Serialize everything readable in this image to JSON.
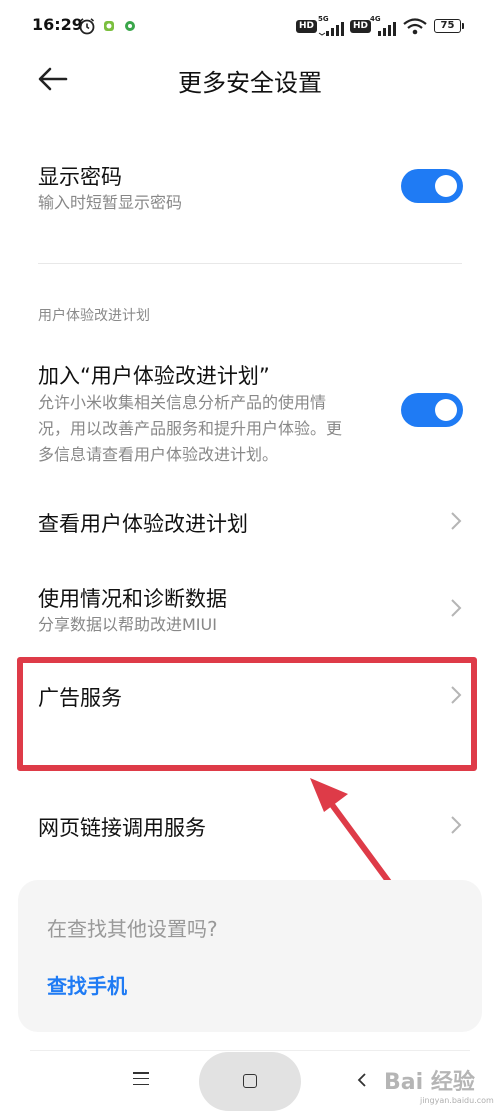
{
  "status_bar": {
    "time": "16:29",
    "battery": "75",
    "hd_label": "HD",
    "net1": "5G",
    "net2": "4G"
  },
  "header": {
    "title": "更多安全设置"
  },
  "rows": {
    "show_password": {
      "title": "显示密码",
      "subtitle": "输入时短暂显示密码",
      "toggle_on": true
    },
    "section_label": "用户体验改进计划",
    "join_program": {
      "title": "加入“用户体验改进计划”",
      "desc_lines": [
        "允许小米收集相关信息分析产品的使用情",
        "况，用以改善产品服务和提升用户体验。更",
        "多信息请查看用户体验改进计划。"
      ],
      "toggle_on": true
    },
    "view_program": {
      "title": "查看用户体验改进计划"
    },
    "usage_diagnostics": {
      "title": "使用情况和诊断数据",
      "subtitle": "分享数据以帮助改进MIUI"
    },
    "ad_service": {
      "title": "广告服务"
    },
    "web_link_service": {
      "title": "网页链接调用服务"
    }
  },
  "search_card": {
    "question": "在查找其他设置吗?",
    "link": "查找手机"
  },
  "watermark": {
    "text": "Bai 经验",
    "sub": "jingyan.baidu.com"
  },
  "colors": {
    "accent": "#1f7bf4",
    "highlight": "#de3b48"
  }
}
